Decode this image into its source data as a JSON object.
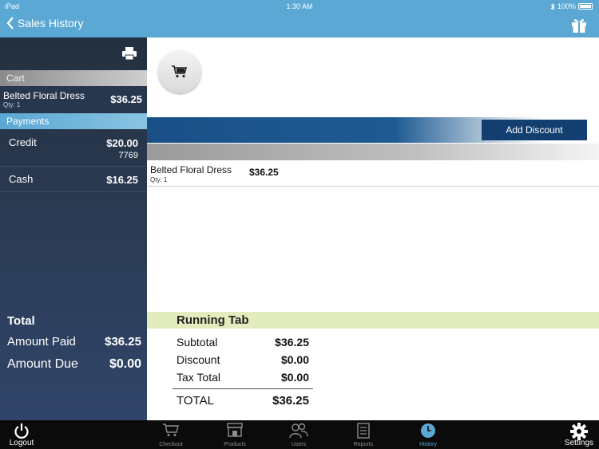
{
  "status_bar": {
    "device": "iPad",
    "time": "1:30 AM",
    "battery": "100%"
  },
  "nav": {
    "back_label": "Sales History"
  },
  "left": {
    "cart_header": "Cart",
    "cart_item": {
      "name": "Belted Floral Dress",
      "qty": "Qty: 1",
      "price": "$36.25"
    },
    "payments_header": "Payments",
    "payments": [
      {
        "label": "Credit",
        "amount": "$20.00",
        "ref": "7769"
      },
      {
        "label": "Cash",
        "amount": "$16.25",
        "ref": ""
      }
    ],
    "totals": {
      "title": "Total",
      "amount_paid_label": "Amount Paid",
      "amount_paid_value": "$36.25",
      "amount_due_label": "Amount Due",
      "amount_due_value": "$0.00"
    }
  },
  "main": {
    "add_discount_label": "Add Discount",
    "item": {
      "name": "Belted Floral Dress",
      "qty": "Qty: 1",
      "price": "$36.25"
    },
    "running_tab_title": "Running Tab",
    "summary": {
      "subtotal_label": "Subtotal",
      "subtotal_value": "$36.25",
      "discount_label": "Discount",
      "discount_value": "$0.00",
      "tax_label": "Tax Total",
      "tax_value": "$0.00",
      "total_label": "TOTAL",
      "total_value": "$36.25"
    }
  },
  "tab_bar": {
    "logout": "Logout",
    "checkout": "Checkout",
    "products": "Products",
    "users": "Users",
    "reports": "Reports",
    "history": "History",
    "settings": "Settings"
  },
  "colors": {
    "nav_blue": "#5aa8d3",
    "dark_blue": "#123f70",
    "tab_highlight": "#e3ecbd"
  }
}
